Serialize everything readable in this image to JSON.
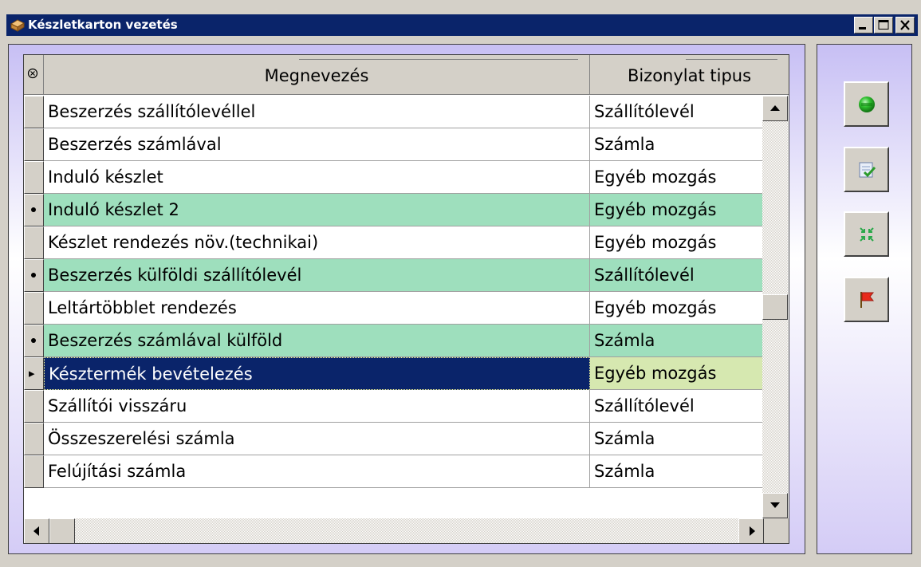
{
  "window": {
    "title": "Készletkarton vezetés",
    "minimize_glyph": "minimize-icon",
    "maximize_glyph": "maximize-icon",
    "close_glyph": "close-icon"
  },
  "grid": {
    "columns": [
      {
        "key": "name",
        "label": "Megnevezés"
      },
      {
        "key": "type",
        "label": "Bizonylat tipus"
      }
    ],
    "rows": [
      {
        "name": "Beszerzés szállítólevéllel",
        "type": "Szállítólevél",
        "state": "normal"
      },
      {
        "name": "Beszerzés számlával",
        "type": "Számla",
        "state": "normal"
      },
      {
        "name": "Induló készlet",
        "type": "Egyéb mozgás",
        "state": "normal"
      },
      {
        "name": "Induló készlet 2",
        "type": "Egyéb mozgás",
        "state": "marked"
      },
      {
        "name": "Készlet rendezés növ.(technikai)",
        "type": "Egyéb mozgás",
        "state": "normal"
      },
      {
        "name": "Beszerzés külföldi szállítólevél",
        "type": "Szállítólevél",
        "state": "marked"
      },
      {
        "name": "Leltártöbblet rendezés",
        "type": "Egyéb mozgás",
        "state": "normal"
      },
      {
        "name": "Beszerzés számlával külföld",
        "type": "Számla",
        "state": "marked"
      },
      {
        "name": "Késztermék bevételezés",
        "type": "Egyéb mozgás",
        "state": "selected"
      },
      {
        "name": "Szállítói visszáru",
        "type": "Szállítólevél",
        "state": "normal"
      },
      {
        "name": "Összeszerelési számla",
        "type": "Számla",
        "state": "normal"
      },
      {
        "name": "Felújítási számla",
        "type": "Számla",
        "state": "normal"
      }
    ]
  },
  "side_buttons": [
    {
      "icon": "green-circle-icon"
    },
    {
      "icon": "checklist-icon"
    },
    {
      "icon": "collapse-arrows-icon"
    },
    {
      "icon": "red-flag-icon"
    }
  ],
  "colors": {
    "titlebar": "#0a246a",
    "marked_row": "#9edfbd",
    "selected_row": "#0a246a",
    "selected_type_cell": "#d6e8b0"
  }
}
